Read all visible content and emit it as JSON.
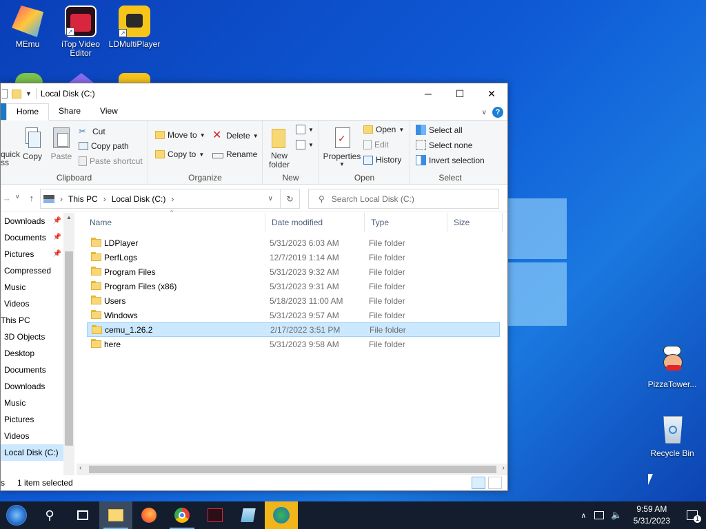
{
  "desktop": {
    "icons": [
      {
        "label": "MEmu"
      },
      {
        "label": "iTop Video Editor"
      },
      {
        "label": "LDMultiPlayer"
      },
      {
        "label": "PizzaTower..."
      },
      {
        "label": "Recycle Bin"
      }
    ]
  },
  "window": {
    "title": "Local Disk (C:)",
    "controls": {
      "minimize": "─",
      "maximize": "☐",
      "close": "✕"
    }
  },
  "ribbon": {
    "tabs": [
      "Home",
      "Share",
      "View"
    ],
    "clipboard": {
      "label": "Clipboard",
      "pin_quick": "quick",
      "pin_quick2": "ss",
      "copy": "Copy",
      "paste": "Paste",
      "cut": "Cut",
      "copy_path": "Copy path",
      "paste_shortcut": "Paste shortcut"
    },
    "organize": {
      "label": "Organize",
      "move_to": "Move to",
      "copy_to": "Copy to",
      "delete": "Delete",
      "rename": "Rename"
    },
    "new": {
      "label": "New",
      "new_folder_line1": "New",
      "new_folder_line2": "folder"
    },
    "open": {
      "label": "Open",
      "properties": "Properties",
      "open": "Open",
      "edit": "Edit",
      "history": "History"
    },
    "select": {
      "label": "Select",
      "select_all": "Select all",
      "select_none": "Select none",
      "invert_selection": "Invert selection"
    }
  },
  "address": {
    "segments": [
      "This PC",
      "Local Disk (C:)"
    ],
    "search_placeholder": "Search Local Disk (C:)"
  },
  "navpane": {
    "items": [
      {
        "label": "Downloads",
        "pinned": true
      },
      {
        "label": "Documents",
        "pinned": true
      },
      {
        "label": "Pictures",
        "pinned": true
      },
      {
        "label": "Compressed",
        "pinned": false
      },
      {
        "label": "Music",
        "pinned": false
      },
      {
        "label": "Videos",
        "pinned": false
      },
      {
        "label": "This PC",
        "pinned": false
      },
      {
        "label": "3D Objects",
        "pinned": false
      },
      {
        "label": "Desktop",
        "pinned": false
      },
      {
        "label": "Documents",
        "pinned": false
      },
      {
        "label": "Downloads",
        "pinned": false
      },
      {
        "label": "Music",
        "pinned": false
      },
      {
        "label": "Pictures",
        "pinned": false
      },
      {
        "label": "Videos",
        "pinned": false
      },
      {
        "label": "Local Disk (C:)",
        "pinned": false
      }
    ]
  },
  "files": {
    "columns": [
      "Name",
      "Date modified",
      "Type",
      "Size"
    ],
    "rows": [
      {
        "name": "LDPlayer",
        "date": "5/31/2023 6:03 AM",
        "type": "File folder"
      },
      {
        "name": "PerfLogs",
        "date": "12/7/2019 1:14 AM",
        "type": "File folder"
      },
      {
        "name": "Program Files",
        "date": "5/31/2023 9:32 AM",
        "type": "File folder"
      },
      {
        "name": "Program Files (x86)",
        "date": "5/31/2023 9:31 AM",
        "type": "File folder"
      },
      {
        "name": "Users",
        "date": "5/18/2023 11:00 AM",
        "type": "File folder"
      },
      {
        "name": "Windows",
        "date": "5/31/2023 9:57 AM",
        "type": "File folder"
      },
      {
        "name": "cemu_1.26.2",
        "date": "2/17/2022 3:51 PM",
        "type": "File folder"
      },
      {
        "name": "here",
        "date": "5/31/2023 9:58 AM",
        "type": "File folder"
      }
    ],
    "selected_row": "cemu_1.26.2"
  },
  "status": {
    "prefix": "s",
    "selection": "1 item selected"
  },
  "taskbar": {
    "time": "9:59 AM",
    "date": "5/31/2023",
    "notification_count": "1"
  }
}
